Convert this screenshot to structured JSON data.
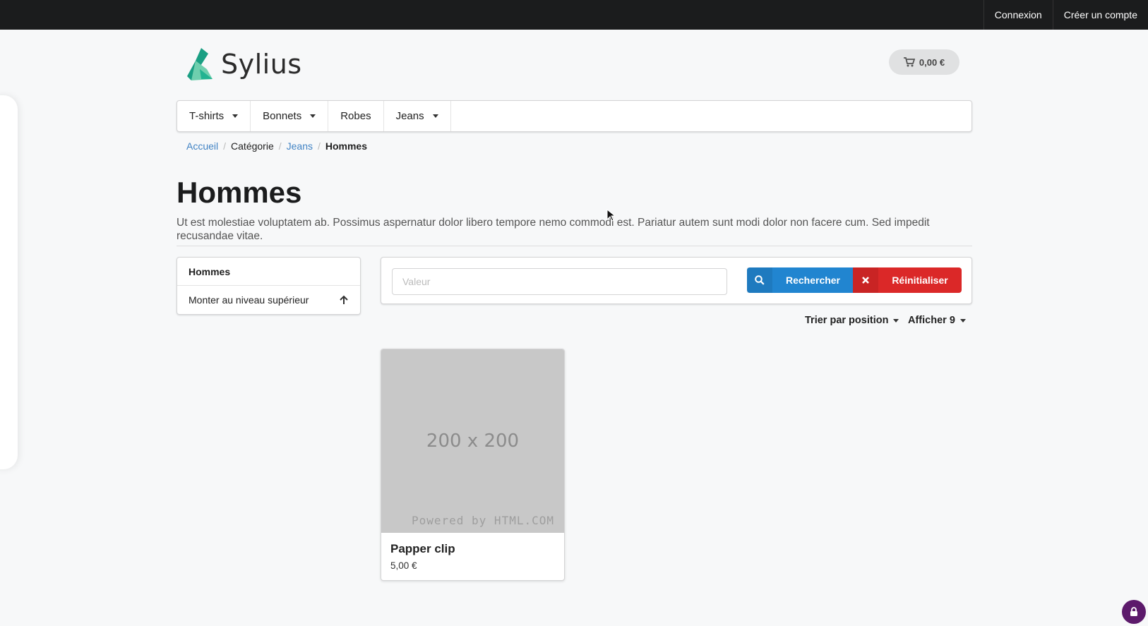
{
  "topbar": {
    "login": "Connexion",
    "register": "Créer un compte"
  },
  "brand": {
    "name": "Sylius",
    "colors": {
      "logo_dark": "#1a9f83",
      "logo_light": "#6fcfae"
    }
  },
  "cart": {
    "icon": "cart-icon",
    "total": "0,00 €"
  },
  "menu": [
    {
      "label": "T-shirts",
      "has_dropdown": true
    },
    {
      "label": "Bonnets",
      "has_dropdown": true
    },
    {
      "label": "Robes",
      "has_dropdown": false
    },
    {
      "label": "Jeans",
      "has_dropdown": true
    }
  ],
  "breadcrumb": {
    "home": "Accueil",
    "category": "Catégorie",
    "parent": "Jeans",
    "current": "Hommes"
  },
  "page": {
    "title": "Hommes",
    "description": "Ut est molestiae voluptatem ab. Possimus aspernatur dolor libero tempore nemo commodi est. Pariatur autem sunt modi dolor non facere cum. Sed impedit recusandae vitae."
  },
  "sidebar": {
    "header": "Hommes",
    "up_label": "Monter au niveau supérieur",
    "up_icon": "arrow-up-icon"
  },
  "search": {
    "placeholder": "Valeur",
    "value": "",
    "search_label": "Rechercher",
    "reset_label": "Réinitialiser",
    "colors": {
      "search": "#2185d0",
      "reset": "#db2828"
    }
  },
  "sorting": {
    "sort_label": "Trier par position",
    "limit_label": "Afficher 9"
  },
  "products": [
    {
      "name": "Papper clip",
      "price": "5,00 €",
      "image_text": "200 x 200",
      "image_credit": "Powered by HTML.COM"
    }
  ]
}
